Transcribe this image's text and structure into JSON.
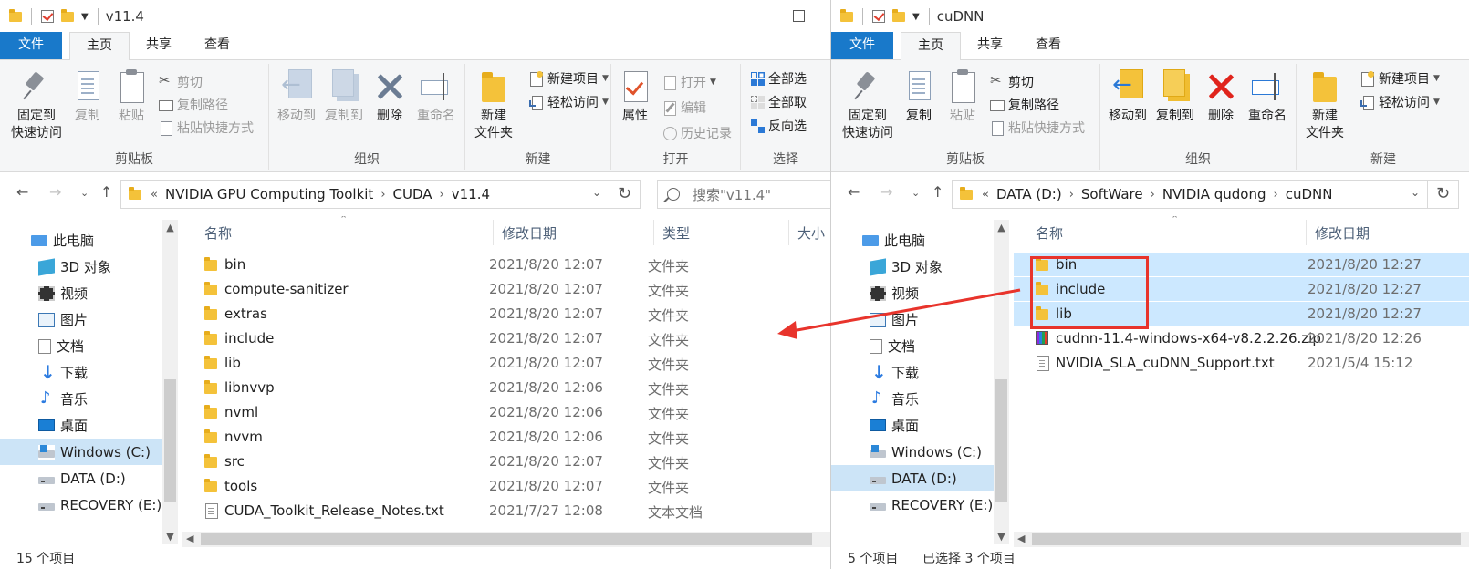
{
  "colors": {
    "accent": "#1979ca",
    "selection": "#cce8ff",
    "annotation": "#e8342c",
    "folder": "#f4c23a"
  },
  "left": {
    "title": "v11.4",
    "tabs": [
      "文件",
      "主页",
      "共享",
      "查看"
    ],
    "ribbon": {
      "clipboard": {
        "pin": "固定到\n快速访问",
        "copy": "复制",
        "paste": "粘贴",
        "cut": "剪切",
        "copy_path": "复制路径",
        "paste_shortcut": "粘贴快捷方式",
        "label": "剪贴板"
      },
      "organize": {
        "move_to": "移动到",
        "copy_to": "复制到",
        "delete": "删除",
        "rename": "重命名",
        "label": "组织"
      },
      "new": {
        "new_folder": "新建\n文件夹",
        "new_item": "新建项目",
        "easy_access": "轻松访问",
        "label": "新建"
      },
      "open": {
        "properties": "属性",
        "open": "打开",
        "edit": "编辑",
        "history": "历史记录",
        "label": "打开"
      },
      "select": {
        "select_all": "全部选",
        "select_none": "全部取",
        "invert": "反向选",
        "label": "选择"
      }
    },
    "breadcrumb": [
      "NVIDIA GPU Computing Toolkit",
      "CUDA",
      "v11.4"
    ],
    "search_placeholder": "搜索\"v11.4\"",
    "nav": [
      "此电脑",
      "3D 对象",
      "视频",
      "图片",
      "文档",
      "下载",
      "音乐",
      "桌面",
      "Windows (C:)",
      "DATA (D:)",
      "RECOVERY (E:)"
    ],
    "columns": [
      "名称",
      "修改日期",
      "类型",
      "大小"
    ],
    "files": [
      {
        "name": "bin",
        "date": "2021/8/20 12:07",
        "type": "文件夹",
        "icon": "folder-icon"
      },
      {
        "name": "compute-sanitizer",
        "date": "2021/8/20 12:07",
        "type": "文件夹",
        "icon": "folder-icon"
      },
      {
        "name": "extras",
        "date": "2021/8/20 12:07",
        "type": "文件夹",
        "icon": "folder-icon"
      },
      {
        "name": "include",
        "date": "2021/8/20 12:07",
        "type": "文件夹",
        "icon": "folder-icon"
      },
      {
        "name": "lib",
        "date": "2021/8/20 12:07",
        "type": "文件夹",
        "icon": "folder-icon"
      },
      {
        "name": "libnvvp",
        "date": "2021/8/20 12:06",
        "type": "文件夹",
        "icon": "folder-icon"
      },
      {
        "name": "nvml",
        "date": "2021/8/20 12:06",
        "type": "文件夹",
        "icon": "folder-icon"
      },
      {
        "name": "nvvm",
        "date": "2021/8/20 12:06",
        "type": "文件夹",
        "icon": "folder-icon"
      },
      {
        "name": "src",
        "date": "2021/8/20 12:07",
        "type": "文件夹",
        "icon": "folder-icon"
      },
      {
        "name": "tools",
        "date": "2021/8/20 12:07",
        "type": "文件夹",
        "icon": "folder-icon"
      },
      {
        "name": "CUDA_Toolkit_Release_Notes.txt",
        "date": "2021/7/27 12:08",
        "type": "文本文档",
        "icon": "text-file-icon"
      }
    ],
    "status": "15 个项目"
  },
  "right": {
    "title": "cuDNN",
    "tabs": [
      "文件",
      "主页",
      "共享",
      "查看"
    ],
    "ribbon": {
      "clipboard": {
        "pin": "固定到\n快速访问",
        "copy": "复制",
        "paste": "粘贴",
        "cut": "剪切",
        "copy_path": "复制路径",
        "paste_shortcut": "粘贴快捷方式",
        "label": "剪贴板"
      },
      "organize": {
        "move_to": "移动到",
        "copy_to": "复制到",
        "delete": "删除",
        "rename": "重命名",
        "label": "组织"
      },
      "new": {
        "new_folder": "新建\n文件夹",
        "new_item": "新建项目",
        "easy_access": "轻松访问",
        "label": "新建"
      }
    },
    "breadcrumb": [
      "DATA (D:)",
      "SoftWare",
      "NVIDIA qudong",
      "cuDNN"
    ],
    "nav": [
      "此电脑",
      "3D 对象",
      "视频",
      "图片",
      "文档",
      "下载",
      "音乐",
      "桌面",
      "Windows (C:)",
      "DATA (D:)",
      "RECOVERY (E:)"
    ],
    "columns": [
      "名称",
      "修改日期"
    ],
    "files": [
      {
        "name": "bin",
        "date": "2021/8/20 12:27",
        "icon": "folder-icon",
        "selected": true
      },
      {
        "name": "include",
        "date": "2021/8/20 12:27",
        "icon": "folder-icon",
        "selected": true
      },
      {
        "name": "lib",
        "date": "2021/8/20 12:27",
        "icon": "folder-icon",
        "selected": true
      },
      {
        "name": "cudnn-11.4-windows-x64-v8.2.2.26.zip",
        "date": "2021/8/20 12:26",
        "icon": "archive-icon",
        "selected": false
      },
      {
        "name": "NVIDIA_SLA_cuDNN_Support.txt",
        "date": "2021/5/4 15:12",
        "icon": "text-file-icon",
        "selected": false
      }
    ],
    "status": "5 个项目",
    "status_selected": "已选择 3 个项目"
  }
}
